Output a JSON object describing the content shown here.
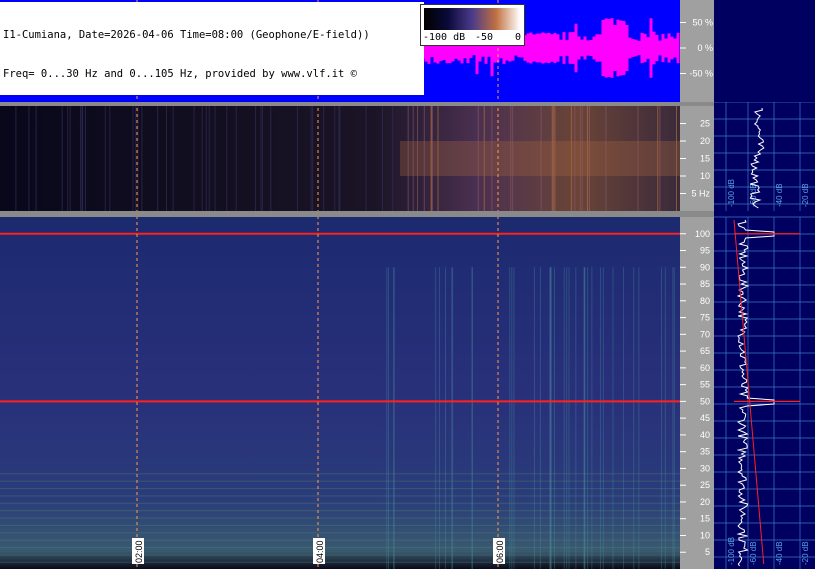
{
  "header": {
    "title_line1": "I1-Cumiana, Date=2026-04-06 Time=08:00 (Geophone/E-field))",
    "title_line2": "Freq= 0...30 Hz and 0...105 Hz, provided by www.vlf.it ©"
  },
  "colorbar": {
    "labels": [
      "-100 dB",
      "-50",
      "0"
    ]
  },
  "colors": {
    "waveform": "#ff00ff",
    "waveform_bg": "#0000ff",
    "power_line": "#ff2020",
    "time_marker": "#ff9a50",
    "side_bg": "#000060",
    "side_grid": "#3c78c8",
    "spectrum_trace": "#ffffff"
  },
  "chart_data": [
    {
      "type": "area",
      "panel": "waveform",
      "ylabel_ticks": [
        "50 %",
        "0 %",
        "-50 %"
      ],
      "ylim": [
        -100,
        100
      ],
      "grid": true
    },
    {
      "type": "heatmap",
      "panel": "spectrogram-low",
      "ylim": [
        0,
        30
      ],
      "yticks": [
        5,
        10,
        15,
        20,
        25
      ],
      "ytick_labels": [
        "5 Hz",
        "10",
        "15",
        "20",
        "25"
      ],
      "time_markers": [
        "02:00",
        "04:00",
        "06:00"
      ],
      "colorbar_db": [
        -100,
        0
      ]
    },
    {
      "type": "heatmap",
      "panel": "spectrogram-high",
      "ylim": [
        0,
        105
      ],
      "yticks": [
        5,
        10,
        15,
        20,
        25,
        30,
        35,
        40,
        45,
        50,
        55,
        60,
        65,
        70,
        75,
        80,
        85,
        90,
        95,
        100
      ],
      "ytick_labels": [
        "5",
        "10",
        "15",
        "20",
        "25",
        "30",
        "35",
        "40",
        "45",
        "50",
        "55",
        "60",
        "65",
        "70",
        "75",
        "80",
        "85",
        "90",
        "95",
        "100"
      ],
      "time_labels": [
        "02:00",
        "04:00",
        "06:00"
      ],
      "x_markers": [
        "02:00",
        "04:00",
        "06:00"
      ],
      "power_line_hz": [
        50,
        100
      ]
    },
    {
      "type": "line",
      "panel": "spectrum-low",
      "xlabels": [
        "-100 dB",
        "-60 dB",
        "-40 dB",
        "-20 dB"
      ]
    },
    {
      "type": "line",
      "panel": "spectrum-high",
      "xlabels": [
        "-100 dB",
        "-60 dB",
        "-40 dB",
        "-20 dB"
      ],
      "peaks_hz": [
        50,
        100
      ]
    }
  ]
}
